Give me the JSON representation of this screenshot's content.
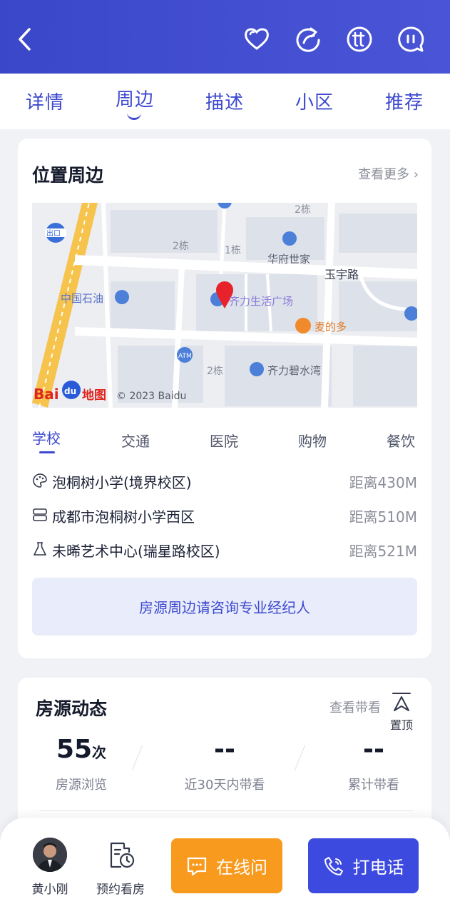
{
  "header": {
    "back_icon": "chevron-left-icon",
    "actions": [
      "heart-icon",
      "share-icon",
      "tt-icon",
      "chat-icon"
    ]
  },
  "tabs": [
    {
      "label": "详情",
      "active": false
    },
    {
      "label": "周边",
      "active": true
    },
    {
      "label": "描述",
      "active": false
    },
    {
      "label": "小区",
      "active": false
    },
    {
      "label": "推荐",
      "active": false
    }
  ],
  "location": {
    "title": "位置周边",
    "more": "查看更多",
    "map": {
      "labels": [
        "2栋",
        "1栋",
        "华府世家",
        "玉宇路",
        "中国石油",
        "齐力生活广场",
        "麦的多",
        "ATM",
        "2栋",
        "齐力碧水湾",
        "2栋",
        "出口"
      ],
      "brand": "Bai",
      "brand_du": "du",
      "brand_map": "地图",
      "copyright": "© 2023 Baidu"
    },
    "categories": [
      {
        "label": "学校",
        "active": true
      },
      {
        "label": "交通",
        "active": false
      },
      {
        "label": "医院",
        "active": false
      },
      {
        "label": "购物",
        "active": false
      },
      {
        "label": "餐饮",
        "active": false
      }
    ],
    "pois": [
      {
        "icon": "palette-icon",
        "name": "泡桐树小学(境界校区)",
        "distance": "距离430M"
      },
      {
        "icon": "school-icon",
        "name": "成都市泡桐树小学西区",
        "distance": "距离510M"
      },
      {
        "icon": "flask-icon",
        "name": "未晞艺术中心(瑞星路校区)",
        "distance": "距离521M"
      }
    ],
    "consult_text": "房源周边请咨询专业经纪人"
  },
  "dynamics": {
    "title": "房源动态",
    "more": "查看带看",
    "stats": [
      {
        "value": "55",
        "unit": "次",
        "label": "房源浏览"
      },
      {
        "value": "--",
        "unit": "",
        "label": "近30天内带看"
      },
      {
        "value": "--",
        "unit": "",
        "label": "累计带看"
      }
    ]
  },
  "to_top": {
    "label": "置顶"
  },
  "bottom_bar": {
    "agent_name": "黄小刚",
    "appointment_label": "预约看房",
    "online_label": "在线问",
    "call_label": "打电话"
  },
  "colors": {
    "primary": "#3d49cf",
    "orange": "#f89a1e",
    "call": "#3d4ae0"
  }
}
